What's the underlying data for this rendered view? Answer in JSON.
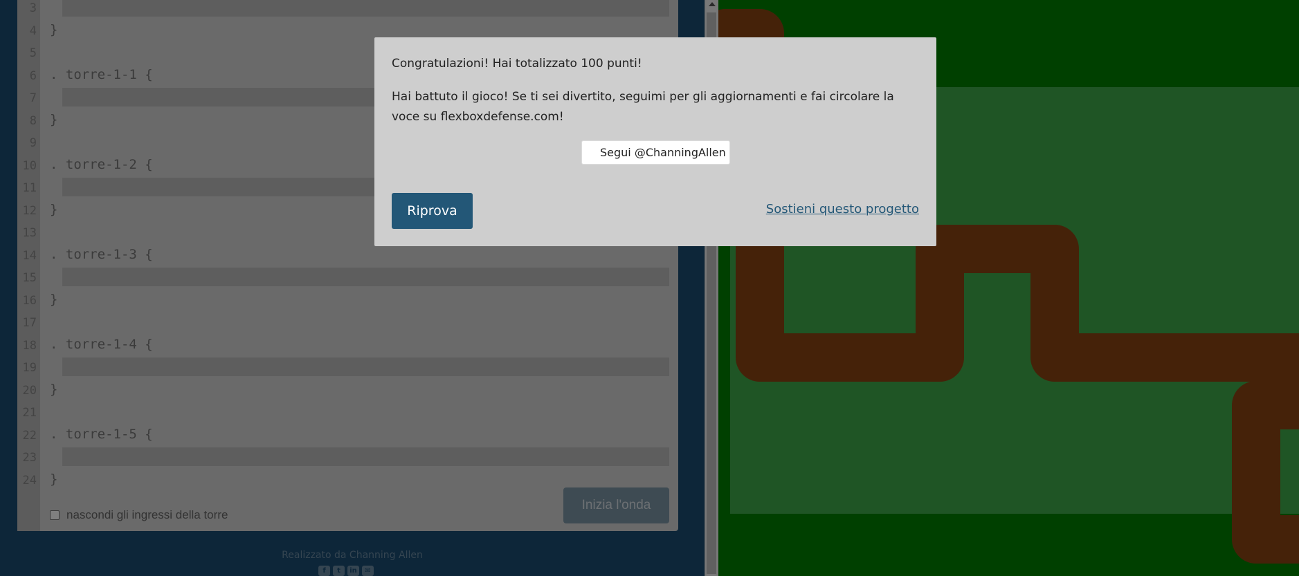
{
  "editor": {
    "lines": [
      {
        "num": "3",
        "text": "",
        "input": true
      },
      {
        "num": "4",
        "text": "}",
        "input": false
      },
      {
        "num": "5",
        "text": "",
        "input": false
      },
      {
        "num": "6",
        "text": ". torre-1-1 {",
        "input": false
      },
      {
        "num": "7",
        "text": "",
        "input": true
      },
      {
        "num": "8",
        "text": "}",
        "input": false
      },
      {
        "num": "9",
        "text": "",
        "input": false
      },
      {
        "num": "10",
        "text": ". torre-1-2 {",
        "input": false
      },
      {
        "num": "11",
        "text": "",
        "input": true
      },
      {
        "num": "12",
        "text": "}",
        "input": false
      },
      {
        "num": "13",
        "text": "",
        "input": false
      },
      {
        "num": "14",
        "text": ". torre-1-3 {",
        "input": false
      },
      {
        "num": "15",
        "text": "",
        "input": true
      },
      {
        "num": "16",
        "text": "}",
        "input": false
      },
      {
        "num": "17",
        "text": "",
        "input": false
      },
      {
        "num": "18",
        "text": ". torre-1-4 {",
        "input": false
      },
      {
        "num": "19",
        "text": "",
        "input": true
      },
      {
        "num": "20",
        "text": "}",
        "input": false
      },
      {
        "num": "21",
        "text": "",
        "input": false
      },
      {
        "num": "22",
        "text": ". torre-1-5 {",
        "input": false
      },
      {
        "num": "23",
        "text": "",
        "input": true
      },
      {
        "num": "24",
        "text": "}",
        "input": false
      }
    ],
    "start_wave_label": "Inizia l'onda",
    "hide_inputs_label": "nascondi gli ingressi della torre",
    "hide_inputs_checked": false
  },
  "footer": {
    "credit": "Realizzato da Channing Allen",
    "social_icons": [
      "facebook-icon",
      "twitter-icon",
      "linkedin-icon",
      "email-icon"
    ]
  },
  "board": {
    "background_color": "#008000",
    "area_color": "#3fab4a",
    "path_color": "#8b4513"
  },
  "modal": {
    "title": "Congratulazioni! Hai totalizzato 100 punti!",
    "body": "Hai battuto il gioco! Se ti sei divertito, seguimi per gli aggiornamenti e fai circolare la voce su flexboxdefense.com!",
    "follow_label": "Segui @ChanningAllen",
    "retry_label": "Riprova",
    "support_label": "Sostieni questo progetto",
    "retry_color": "#235777"
  }
}
